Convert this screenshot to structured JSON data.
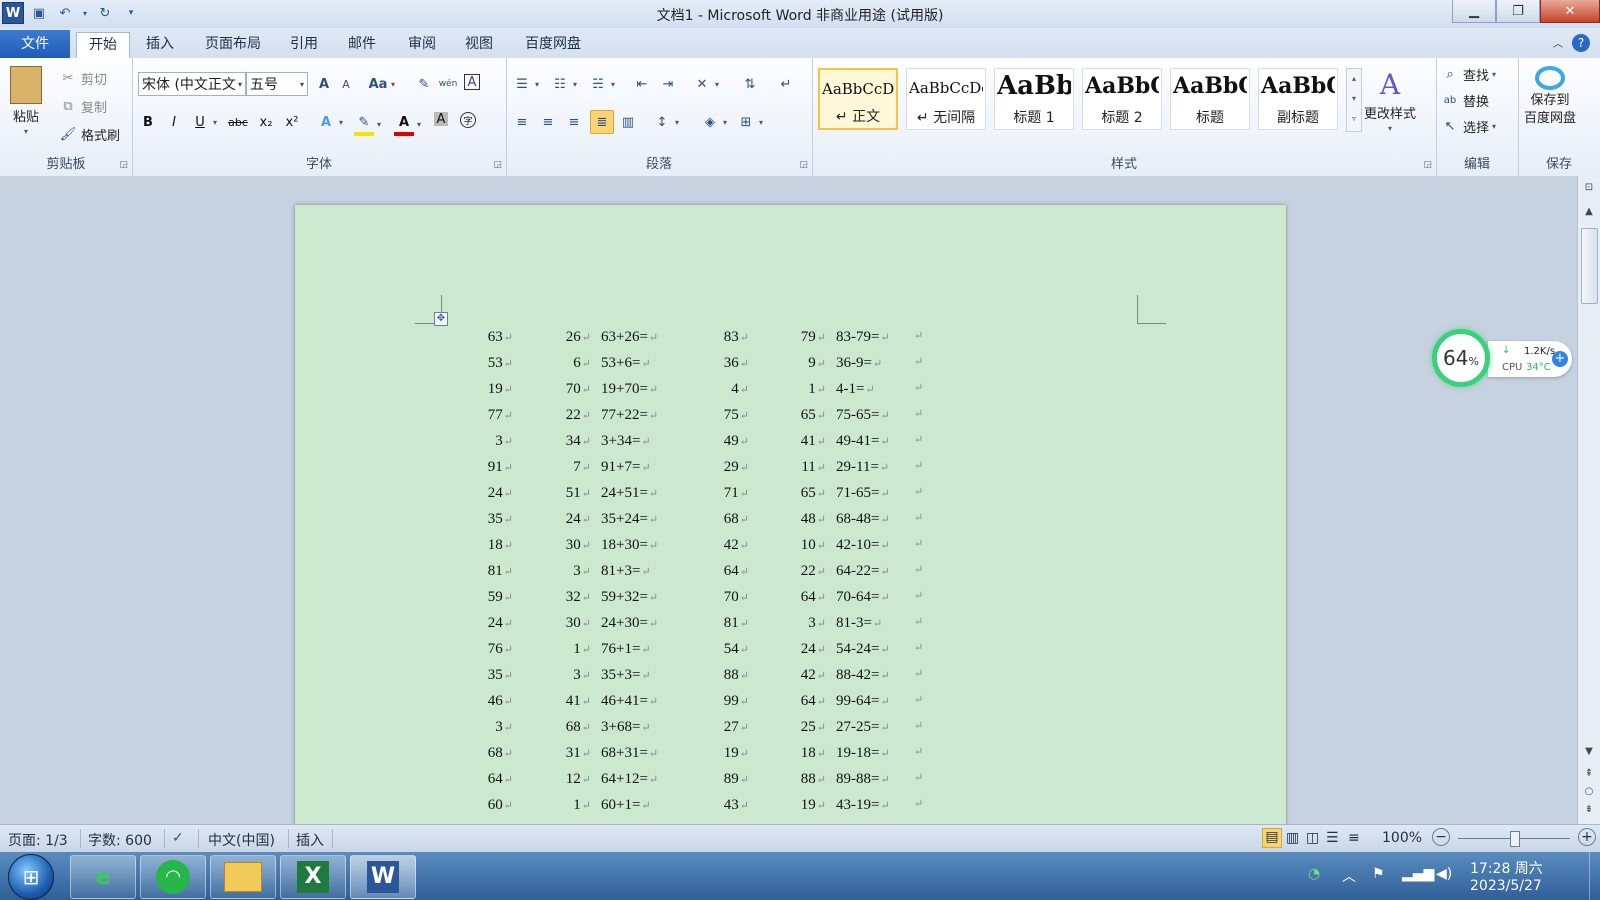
{
  "window": {
    "title": "文档1 - Microsoft Word 非商业用途 (试用版)"
  },
  "qat": {
    "logo": "W",
    "save_icon": "save-icon",
    "undo_icon": "undo-icon",
    "redo_icon": "redo-icon",
    "customize_icon": "customize-icon"
  },
  "tabs": [
    {
      "label": "文件"
    },
    {
      "label": "开始"
    },
    {
      "label": "插入"
    },
    {
      "label": "页面布局"
    },
    {
      "label": "引用"
    },
    {
      "label": "邮件"
    },
    {
      "label": "审阅"
    },
    {
      "label": "视图"
    },
    {
      "label": "百度网盘"
    }
  ],
  "clipboard": {
    "paste": "粘贴",
    "cut": "剪切",
    "copy": "复制",
    "format_painter": "格式刷",
    "label": "剪贴板"
  },
  "font": {
    "name": "宋体 (中文正文",
    "size": "五号",
    "grow": "A",
    "shrink": "A",
    "change_case": "Aa",
    "phonetic": "wén",
    "char_border": "A",
    "bold": "B",
    "italic": "I",
    "underline": "U",
    "strike": "abc",
    "subscript": "x₂",
    "superscript": "x²",
    "text_effects": "A",
    "font_color": "A",
    "char_shading": "A",
    "enclose": "字",
    "label": "字体"
  },
  "paragraph": {
    "label": "段落"
  },
  "styles": {
    "items": [
      {
        "sample": "AaBbCcDd",
        "name": "↵ 正文"
      },
      {
        "sample": "AaBbCcDd",
        "name": "↵ 无间隔"
      },
      {
        "sample": "AaBb",
        "name": "标题 1"
      },
      {
        "sample": "AaBbC",
        "name": "标题 2"
      },
      {
        "sample": "AaBbC",
        "name": "标题"
      },
      {
        "sample": "AaBbC",
        "name": "副标题"
      }
    ],
    "change_styles": "更改样式",
    "label": "样式"
  },
  "editing": {
    "find": "查找",
    "replace": "替换",
    "select": "选择",
    "label": "编辑"
  },
  "save": {
    "baidu": "保存到\n百度网盘",
    "label": "保存"
  },
  "document": {
    "para_mark": "↵",
    "rows": [
      {
        "a": "63",
        "b": "26",
        "e1": "63+26=",
        "c": "83",
        "d": "79",
        "e2": "83-79="
      },
      {
        "a": "53",
        "b": "6",
        "e1": "53+6=",
        "c": "36",
        "d": "9",
        "e2": "36-9="
      },
      {
        "a": "19",
        "b": "70",
        "e1": "19+70=",
        "c": "4",
        "d": "1",
        "e2": "4-1="
      },
      {
        "a": "77",
        "b": "22",
        "e1": "77+22=",
        "c": "75",
        "d": "65",
        "e2": "75-65="
      },
      {
        "a": "3",
        "b": "34",
        "e1": "3+34=",
        "c": "49",
        "d": "41",
        "e2": "49-41="
      },
      {
        "a": "91",
        "b": "7",
        "e1": "91+7=",
        "c": "29",
        "d": "11",
        "e2": "29-11="
      },
      {
        "a": "24",
        "b": "51",
        "e1": "24+51=",
        "c": "71",
        "d": "65",
        "e2": "71-65="
      },
      {
        "a": "35",
        "b": "24",
        "e1": "35+24=",
        "c": "68",
        "d": "48",
        "e2": "68-48="
      },
      {
        "a": "18",
        "b": "30",
        "e1": "18+30=",
        "c": "42",
        "d": "10",
        "e2": "42-10="
      },
      {
        "a": "81",
        "b": "3",
        "e1": "81+3=",
        "c": "64",
        "d": "22",
        "e2": "64-22="
      },
      {
        "a": "59",
        "b": "32",
        "e1": "59+32=",
        "c": "70",
        "d": "64",
        "e2": "70-64="
      },
      {
        "a": "24",
        "b": "30",
        "e1": "24+30=",
        "c": "81",
        "d": "3",
        "e2": "81-3="
      },
      {
        "a": "76",
        "b": "1",
        "e1": "76+1=",
        "c": "54",
        "d": "24",
        "e2": "54-24="
      },
      {
        "a": "35",
        "b": "3",
        "e1": "35+3=",
        "c": "88",
        "d": "42",
        "e2": "88-42="
      },
      {
        "a": "46",
        "b": "41",
        "e1": "46+41=",
        "c": "99",
        "d": "64",
        "e2": "99-64="
      },
      {
        "a": "3",
        "b": "68",
        "e1": "3+68=",
        "c": "27",
        "d": "25",
        "e2": "27-25="
      },
      {
        "a": "68",
        "b": "31",
        "e1": "68+31=",
        "c": "19",
        "d": "18",
        "e2": "19-18="
      },
      {
        "a": "64",
        "b": "12",
        "e1": "64+12=",
        "c": "89",
        "d": "88",
        "e2": "89-88="
      },
      {
        "a": "60",
        "b": "1",
        "e1": "60+1=",
        "c": "43",
        "d": "19",
        "e2": "43-19="
      }
    ]
  },
  "status": {
    "page": "页面: 1/3",
    "words": "字数: 600",
    "language": "中文(中国)",
    "mode": "插入",
    "zoom": "100%",
    "zoom_slider_value": 0.5
  },
  "widget": {
    "percent": "64",
    "unit": "%",
    "speed": "1.2K/s",
    "cpu_label": "CPU",
    "cpu_temp": "34°C"
  },
  "tray": {
    "time": "17:28 周六",
    "date": "2023/5/27"
  },
  "taskbar": [
    "ie",
    "wifi-assistant",
    "explorer",
    "excel",
    "word"
  ]
}
